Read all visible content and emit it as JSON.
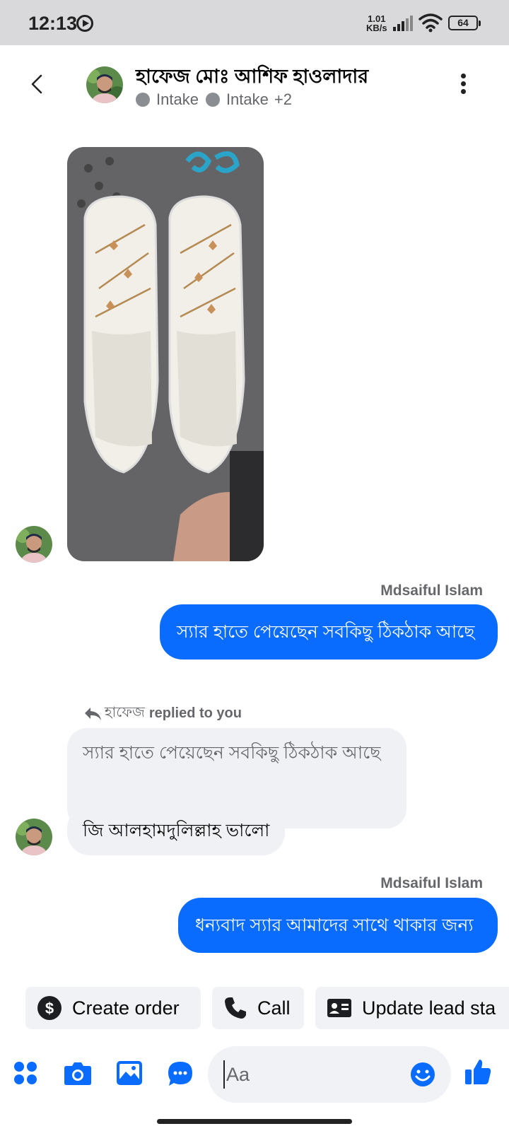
{
  "status_bar": {
    "time": "12:13",
    "net_speed_value": "1.01",
    "net_speed_unit": "KB/s",
    "battery": "64"
  },
  "header": {
    "contact_name": "হাফেজ মোঃ আশিফ হাওলাদার",
    "tags": [
      "Intake",
      "Intake"
    ],
    "extra_tags": "+2"
  },
  "messages": {
    "outgoing_1": {
      "sender": "Mdsaiful Islam",
      "text": "স্যার হাতে পেয়েছেন সবকিছু ঠিকঠাক আছে"
    },
    "reply": {
      "reply_who": "হাফেজ",
      "reply_action": "replied to you",
      "quoted_text": "স্যার হাতে পেয়েছেন সবকিছু ঠিকঠাক আছে",
      "text": "জি আলহামদুলিল্লাহ ভালো"
    },
    "outgoing_2": {
      "sender": "Mdsaiful Islam",
      "text": "ধন্যবাদ স্যার আমাদের সাথে থাকার জন্য"
    }
  },
  "quick_actions": {
    "create_order": "Create order",
    "call": "Call",
    "update_lead": "Update lead sta"
  },
  "composer": {
    "placeholder": "Aa"
  },
  "colors": {
    "accent": "#0a6cff",
    "incoming_bubble": "#eff1f5",
    "muted_text": "#65676b"
  }
}
